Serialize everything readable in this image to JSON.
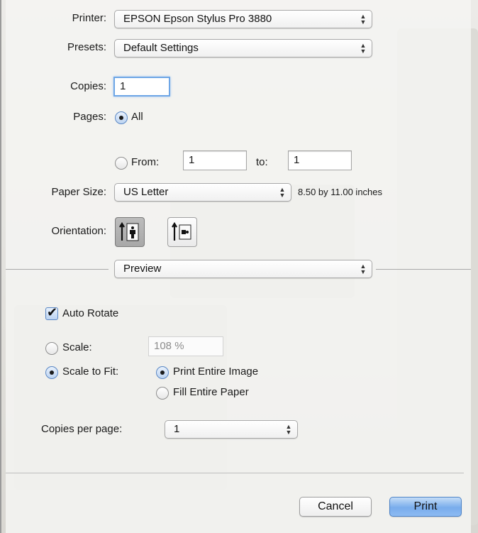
{
  "printer": {
    "label": "Printer:",
    "value": "EPSON Epson Stylus Pro 3880"
  },
  "presets": {
    "label": "Presets:",
    "value": "Default Settings"
  },
  "copies": {
    "label": "Copies:",
    "value": "1"
  },
  "pages": {
    "label": "Pages:",
    "all_label": "All",
    "from_label": "From:",
    "from_value": "1",
    "to_label": "to:",
    "to_value": "1",
    "selected": "all"
  },
  "paper_size": {
    "label": "Paper Size:",
    "value": "US Letter",
    "dimensions": "8.50 by 11.00 inches"
  },
  "orientation": {
    "label": "Orientation:",
    "selected": "portrait"
  },
  "section_popup": {
    "value": "Preview"
  },
  "preview": {
    "auto_rotate_label": "Auto Rotate",
    "auto_rotate_checked": true,
    "scale_label": "Scale:",
    "scale_value": "108 %",
    "scale_to_fit_label": "Scale to Fit:",
    "scale_mode": "scale-to-fit",
    "print_entire_image_label": "Print Entire Image",
    "fill_entire_paper_label": "Fill Entire Paper",
    "fit_mode": "print-entire-image",
    "copies_per_page_label": "Copies per page:",
    "copies_per_page_value": "1"
  },
  "buttons": {
    "cancel": "Cancel",
    "print": "Print"
  },
  "colors": {
    "accent": "#79acec",
    "focus_ring": "#6ea6e6",
    "background": "#f4f4f2"
  }
}
